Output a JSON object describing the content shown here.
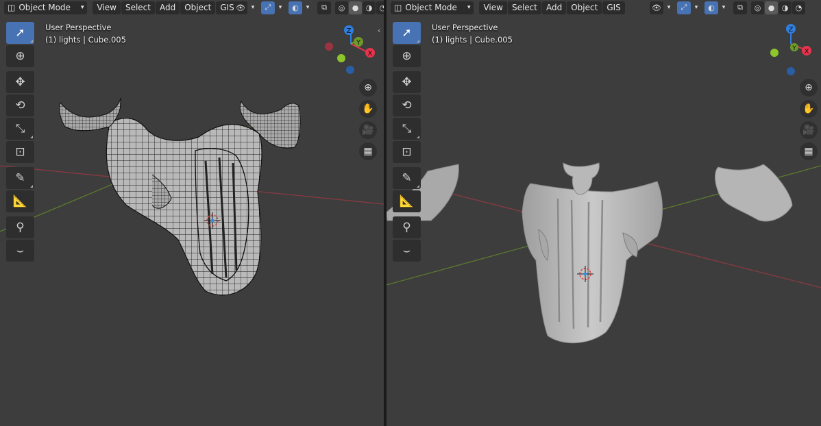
{
  "viewports": [
    {
      "id": "left",
      "mode_label": "Object Mode",
      "menus": [
        "View",
        "Select",
        "Add",
        "Object",
        "GIS"
      ],
      "view_title": "User Perspective",
      "object_info": "(1) lights | Cube.005",
      "shading": "wireframe-overlay"
    },
    {
      "id": "right",
      "mode_label": "Object Mode",
      "menus": [
        "View",
        "Select",
        "Add",
        "Object",
        "GIS"
      ],
      "view_title": "User Perspective",
      "object_info": "(1) lights | Cube.005",
      "shading": "solid"
    }
  ],
  "gizmo_axes": {
    "x": "X",
    "y": "Y",
    "z": "Z"
  },
  "tools": [
    "select-box-icon",
    "cursor-icon",
    "move-icon",
    "rotate-icon",
    "scale-icon",
    "transform-icon",
    "annotate-icon",
    "measure-icon",
    "gis-tool-icon",
    "curve-tool-icon"
  ],
  "nav_tools": [
    "zoom-icon",
    "hand-pan-icon",
    "camera-icon",
    "grid-ortho-icon"
  ],
  "colors": {
    "viewport_bg": "#3d3d3d",
    "accent": "#4772b3",
    "axis_x": "#e8344c",
    "axis_y": "#7dab2a",
    "axis_z": "#2f7ee0",
    "mesh_solid": "#bdbdbd"
  }
}
